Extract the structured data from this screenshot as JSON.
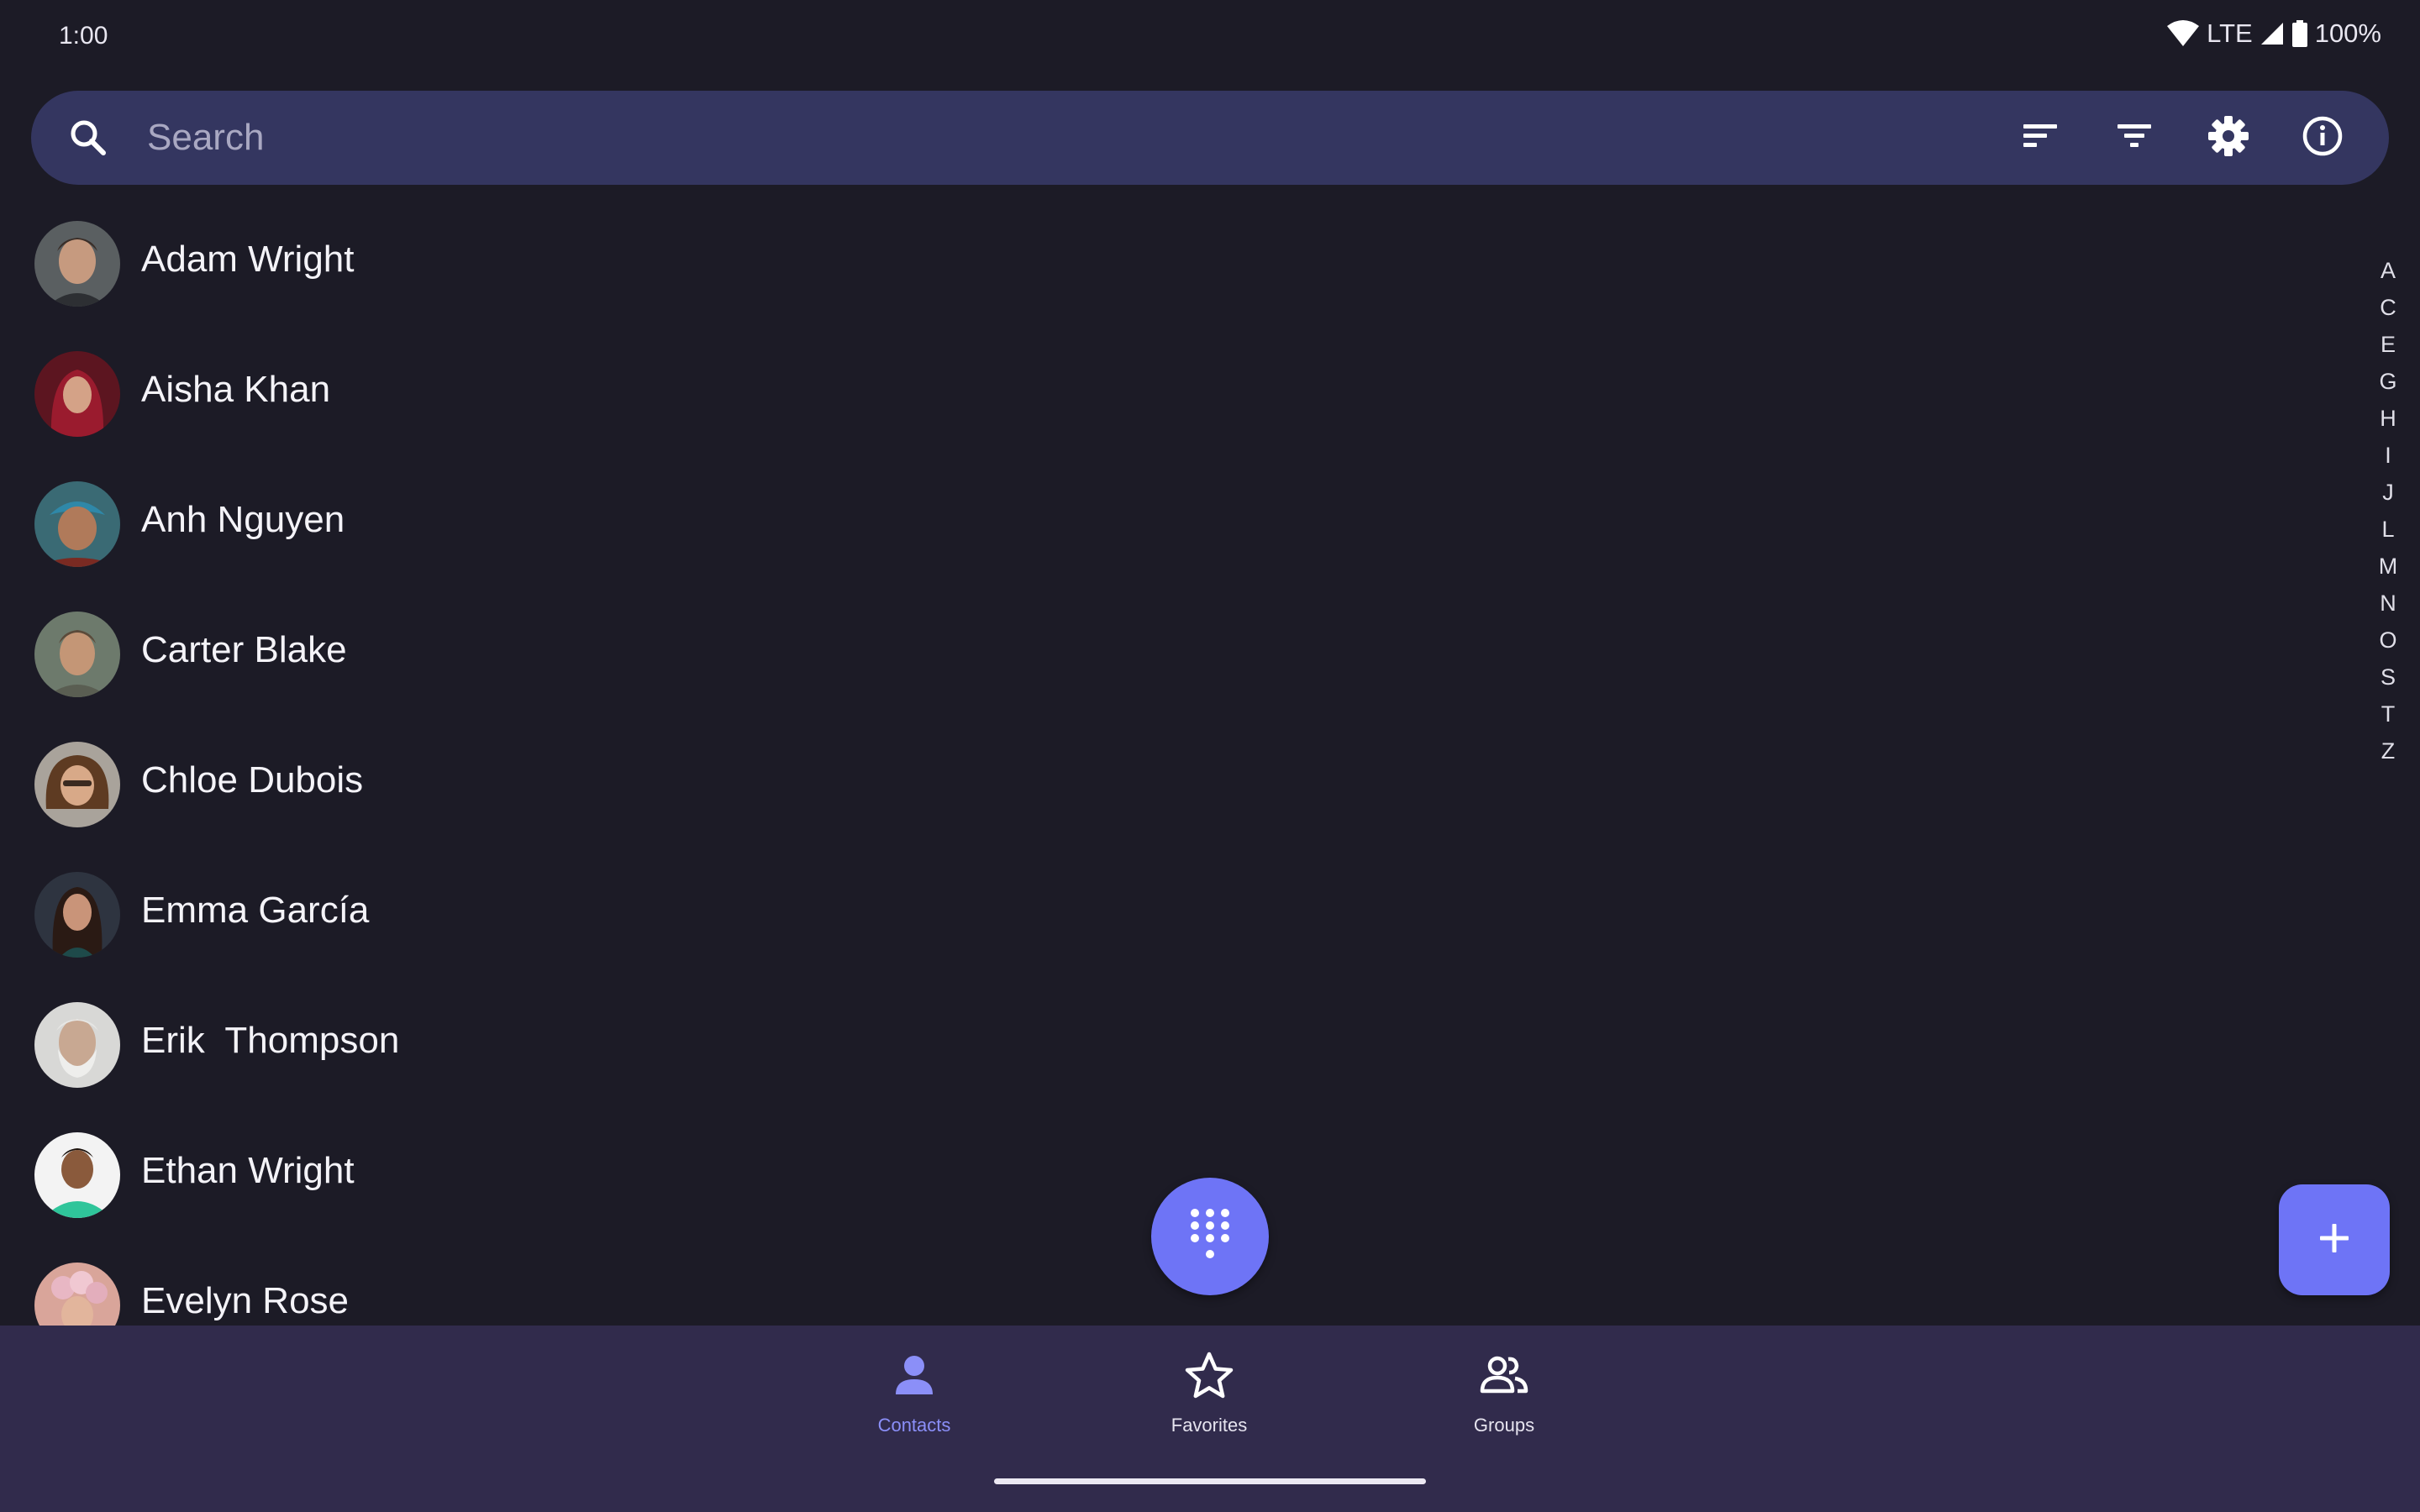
{
  "status_bar": {
    "time": "1:00",
    "network": "LTE",
    "battery": "100%",
    "icons": [
      "wifi-icon",
      "cell-signal-icon",
      "battery-icon"
    ]
  },
  "search": {
    "placeholder": "Search",
    "value": "",
    "actions": [
      "sort-icon",
      "filter-icon",
      "settings-gear-icon",
      "info-icon"
    ]
  },
  "contacts": [
    {
      "name": "Adam Wright",
      "avatar": "avatar-adam-wright"
    },
    {
      "name": "Aisha Khan",
      "avatar": "avatar-aisha-khan"
    },
    {
      "name": "Anh Nguyen",
      "avatar": "avatar-anh-nguyen"
    },
    {
      "name": "Carter Blake",
      "avatar": "avatar-carter-blake"
    },
    {
      "name": "Chloe Dubois",
      "avatar": "avatar-chloe-dubois"
    },
    {
      "name": "Emma García",
      "avatar": "avatar-emma-garcia"
    },
    {
      "name": "Erik  Thompson",
      "avatar": "avatar-erik-thompson"
    },
    {
      "name": "Ethan Wright",
      "avatar": "avatar-ethan-wright"
    },
    {
      "name": "Evelyn Rose",
      "avatar": "avatar-evelyn-rose"
    }
  ],
  "alphabet_index": [
    "A",
    "C",
    "E",
    "G",
    "H",
    "I",
    "J",
    "L",
    "M",
    "N",
    "O",
    "S",
    "T",
    "Z"
  ],
  "fabs": {
    "dialpad_icon": "dialpad-icon",
    "add_icon": "plus-icon"
  },
  "bottom_nav": {
    "items": [
      {
        "label": "Contacts",
        "icon": "person-icon",
        "selected": true
      },
      {
        "label": "Favorites",
        "icon": "star-icon",
        "selected": false
      },
      {
        "label": "Groups",
        "icon": "group-icon",
        "selected": false
      }
    ]
  },
  "colors": {
    "background": "#1c1b26",
    "search_bar": "#343660",
    "accent": "#6e74f6",
    "nav_background": "#312b4c",
    "nav_selected": "#8b8ff8"
  }
}
